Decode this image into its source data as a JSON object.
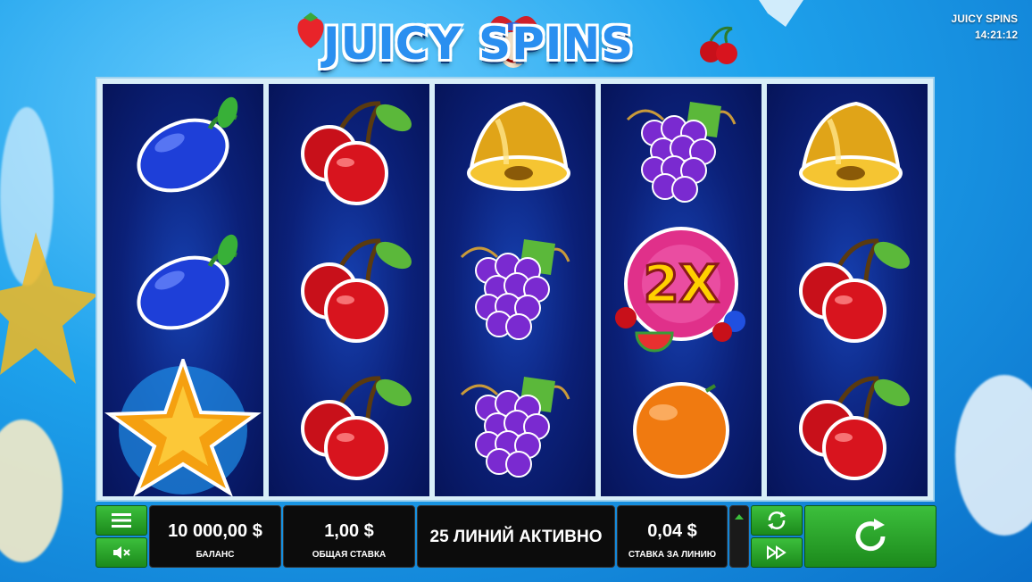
{
  "game": {
    "logo_text": "JUICY SPINS",
    "name_label": "JUICY SPINS",
    "clock": "14:21:12"
  },
  "reels": [
    [
      "plum",
      "plum",
      "star"
    ],
    [
      "cherry",
      "cherry",
      "cherry"
    ],
    [
      "bell",
      "grapes",
      "grapes"
    ],
    [
      "grapes",
      "2x-wild",
      "orange"
    ],
    [
      "bell",
      "cherry",
      "cherry"
    ]
  ],
  "wild_label": "2X",
  "controls": {
    "menu_icon": "hamburger-icon",
    "sound_icon": "mute-icon",
    "balance_value": "10 000,00 $",
    "balance_label": "БАЛАНС",
    "total_bet_value": "1,00 $",
    "total_bet_label": "ОБЩАЯ СТАВКА",
    "lines_text": "25 ЛИНИЙ АКТИВНО",
    "line_bet_value": "0,04 $",
    "line_bet_label": "СТАВКА ЗА ЛИНИЮ",
    "autoplay_icon": "autoplay-icon",
    "fast_icon": "fast-forward-icon",
    "spin_icon": "spin-icon"
  },
  "colors": {
    "control_green": "#2aa52a",
    "reel_blue": "#0b2078"
  }
}
